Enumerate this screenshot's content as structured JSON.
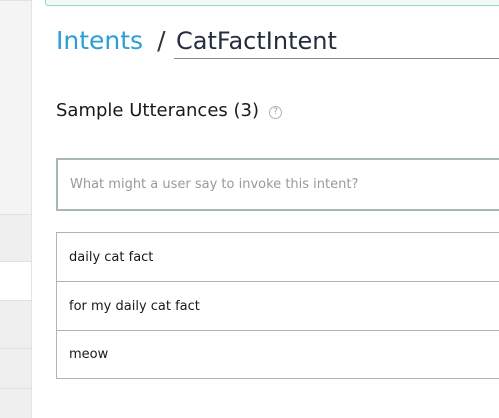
{
  "breadcrumb": {
    "parent_label": "Intents",
    "separator": "/",
    "intent_name": "CatFactIntent"
  },
  "sample_utterances": {
    "heading": "Sample Utterances (3)",
    "help_icon": "question-circle-icon",
    "help_glyph": "?",
    "input_placeholder": "What might a user say to invoke this intent?",
    "items": [
      {
        "text": "daily cat fact"
      },
      {
        "text": "for my daily cat fact"
      },
      {
        "text": "meow"
      }
    ]
  },
  "colors": {
    "link": "#2a9fd6",
    "border": "#aab7b8",
    "banner_border": "#8fd6cb"
  }
}
